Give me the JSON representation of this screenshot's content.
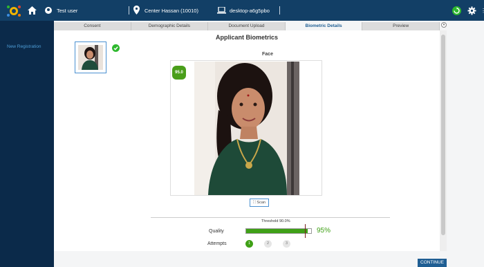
{
  "header": {
    "user_name": "Test user",
    "center_name": "Center Hassan (10010)",
    "machine_name": "desktop-a6g5pbo"
  },
  "sidebar": {
    "items": [
      {
        "label": "New Registration"
      }
    ]
  },
  "tabs": [
    {
      "label": "Consent",
      "active": false
    },
    {
      "label": "Demographic Details",
      "active": false
    },
    {
      "label": "Document Upload",
      "active": false
    },
    {
      "label": "Biometric Details",
      "active": true
    },
    {
      "label": "Preview",
      "active": false
    }
  ],
  "main": {
    "heading": "Applicant Biometrics",
    "modality_label": "Face",
    "score_badge": "95.0",
    "scan_label": "Scan",
    "threshold_label": "Threshold 90.0%",
    "quality_label": "Quality",
    "quality_value": "95%",
    "quality_fraction": 0.95,
    "threshold_fraction": 0.9,
    "attempts_label": "Attempts",
    "attempts": [
      {
        "label": "1",
        "done": true
      },
      {
        "label": "2",
        "done": false
      },
      {
        "label": "3",
        "done": false
      }
    ],
    "continue_label": "CONTINUE"
  },
  "colors": {
    "topbar": "#123f66",
    "accent": "#1f5e93",
    "success": "#3fa016"
  },
  "icons": [
    "logo-icon",
    "home-icon",
    "user-icon",
    "location-pin-icon",
    "laptop-icon",
    "sync-icon",
    "gear-icon",
    "check-circle-icon",
    "scan-icon"
  ]
}
